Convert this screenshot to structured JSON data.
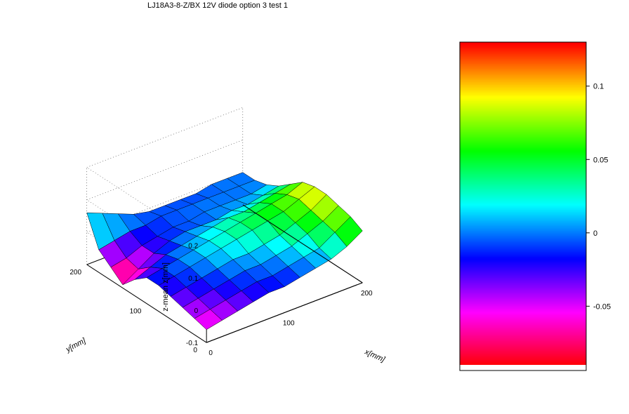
{
  "title": "LJ18A3-8-Z/BX 12V diode option 3 test 1",
  "axes": {
    "x": {
      "label": "x[mm]",
      "ticks": [
        0,
        100,
        200
      ]
    },
    "y": {
      "label": "y[mm]",
      "ticks": [
        0,
        100,
        200
      ]
    },
    "z": {
      "label": "z-mean z[mm]",
      "ticks": [
        -0.1,
        0,
        0.1,
        0.2
      ]
    }
  },
  "colorbar": {
    "ticks": [
      "-0.05",
      "0",
      "0.05",
      "0.1"
    ],
    "range": [
      -0.09,
      0.13
    ]
  },
  "chart_data": {
    "type": "surface",
    "title": "LJ18A3-8-Z/BX 12V diode option 3 test 1",
    "xlabel": "x[mm]",
    "ylabel": "y[mm]",
    "zlabel": "z-mean z[mm]",
    "zlim": [
      -0.1,
      0.2
    ],
    "colormap": "hsv",
    "clim": [
      -0.09,
      0.13
    ],
    "x": [
      0,
      20,
      40,
      60,
      80,
      100,
      120,
      140,
      160,
      180,
      200
    ],
    "y": [
      0,
      20,
      40,
      60,
      80,
      100,
      120,
      140,
      160,
      180,
      200
    ],
    "z": [
      [
        -0.06,
        -0.05,
        -0.04,
        -0.03,
        -0.02,
        -0.02,
        -0.01,
        0.0,
        0.01,
        0.03,
        0.06
      ],
      [
        -0.05,
        -0.04,
        -0.03,
        -0.02,
        -0.01,
        -0.01,
        0.0,
        0.01,
        0.02,
        0.05,
        0.08
      ],
      [
        -0.04,
        -0.03,
        -0.02,
        -0.01,
        0.0,
        0.0,
        0.01,
        0.02,
        0.04,
        0.06,
        0.09
      ],
      [
        -0.03,
        -0.02,
        -0.01,
        0.0,
        0.01,
        0.01,
        0.02,
        0.03,
        0.05,
        0.07,
        0.1
      ],
      [
        -0.02,
        -0.01,
        0.0,
        0.01,
        0.02,
        0.03,
        0.04,
        0.05,
        0.06,
        0.08,
        0.1
      ],
      [
        -0.02,
        -0.01,
        0.0,
        0.01,
        0.02,
        0.03,
        0.04,
        0.05,
        0.06,
        0.07,
        0.09
      ],
      [
        -0.05,
        -0.03,
        -0.01,
        0.0,
        0.01,
        0.02,
        0.03,
        0.03,
        0.04,
        0.05,
        0.06
      ],
      [
        -0.09,
        -0.06,
        -0.03,
        -0.01,
        0.0,
        0.0,
        0.0,
        0.01,
        0.01,
        0.02,
        0.03
      ],
      [
        -0.06,
        -0.05,
        -0.03,
        -0.02,
        -0.01,
        -0.01,
        0.0,
        0.0,
        0.0,
        0.0,
        0.01
      ],
      [
        -0.03,
        -0.02,
        -0.01,
        -0.01,
        0.0,
        0.0,
        0.0,
        0.0,
        0.0,
        0.0,
        0.0
      ],
      [
        0.06,
        0.04,
        0.02,
        0.0,
        -0.01,
        -0.01,
        -0.01,
        -0.01,
        0.0,
        0.0,
        0.0
      ]
    ]
  }
}
